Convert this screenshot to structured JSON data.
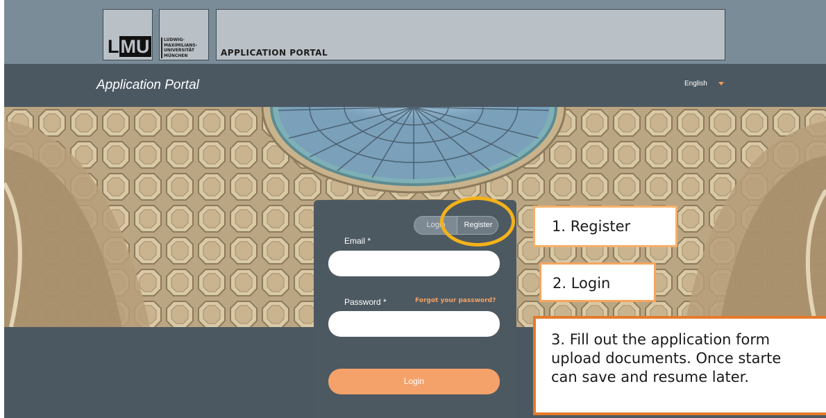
{
  "logo": {
    "lmu": "LMU",
    "university_lines": [
      "LUDWIG-",
      "MAXIMILIANS-",
      "UNIVERSITÄT",
      "MÜNCHEN"
    ],
    "portal_caption": "APPLICATION PORTAL"
  },
  "nav": {
    "title": "Application Portal",
    "language": "English",
    "language_icon": "caret-down-icon"
  },
  "login_card": {
    "toggle_login": "Login",
    "toggle_register": "Register",
    "email_label": "Email *",
    "email_value": "",
    "password_label": "Password *",
    "password_value": "",
    "forgot_link": "Forgot your password?",
    "submit_label": "Login"
  },
  "callouts": {
    "step1": "1. Register",
    "step2": "2. Login",
    "step3_lines": [
      "3. Fill out the application form",
      "upload documents. Once starte",
      "can save and resume later."
    ]
  },
  "colors": {
    "accent_orange": "#f4a26a",
    "highlight_ring": "#f3b21b",
    "nav_bg": "#4c5861",
    "callout_border": "#e57b2a"
  }
}
